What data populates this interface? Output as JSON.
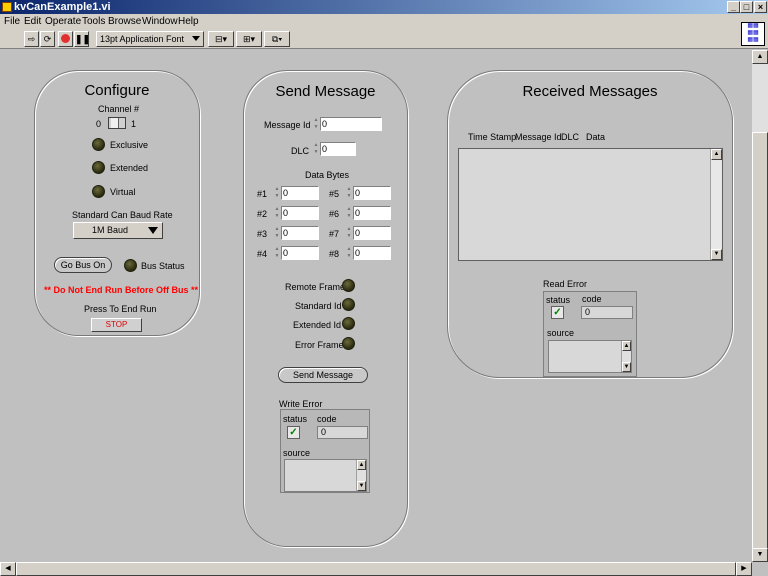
{
  "window": {
    "title": "kvCanExample1.vi"
  },
  "menu": [
    "File",
    "Edit",
    "Operate",
    "Tools",
    "Browse",
    "Window",
    "Help"
  ],
  "toolbar": {
    "font": "13pt Application Font"
  },
  "configure": {
    "title": "Configure",
    "channel_label": "Channel #",
    "channel_min": "0",
    "channel_max": "1",
    "exclusive": "Exclusive",
    "extended": "Extended",
    "virtual": "Virtual",
    "baud_label": "Standard Can Baud Rate",
    "baud_value": "1M Baud",
    "go_bus_on": "Go Bus On",
    "bus_status": "Bus Status",
    "warning": "** Do Not End Run Before Off Bus **",
    "press_end": "Press To End Run",
    "stop": "STOP"
  },
  "send": {
    "title": "Send Message",
    "message_id_label": "Message Id",
    "message_id": "0",
    "dlc_label": "DLC",
    "dlc": "0",
    "data_bytes_label": "Data Bytes",
    "bytes": [
      {
        "label": "#1",
        "value": "0"
      },
      {
        "label": "#2",
        "value": "0"
      },
      {
        "label": "#3",
        "value": "0"
      },
      {
        "label": "#4",
        "value": "0"
      },
      {
        "label": "#5",
        "value": "0"
      },
      {
        "label": "#6",
        "value": "0"
      },
      {
        "label": "#7",
        "value": "0"
      },
      {
        "label": "#8",
        "value": "0"
      }
    ],
    "remote_frame": "Remote Frame",
    "standard_id": "Standard Id",
    "extended_id": "Extended Id",
    "error_frame": "Error Frame",
    "send_button": "Send Message",
    "write_error": {
      "label": "Write Error",
      "status": "status",
      "code_label": "code",
      "code": "0",
      "source": "source"
    }
  },
  "received": {
    "title": "Received Messages",
    "columns": [
      "Time Stamp",
      "Message Id",
      "DLC",
      "Data"
    ],
    "read_error": {
      "label": "Read Error",
      "status": "status",
      "code_label": "code",
      "code": "0",
      "source": "source"
    }
  }
}
